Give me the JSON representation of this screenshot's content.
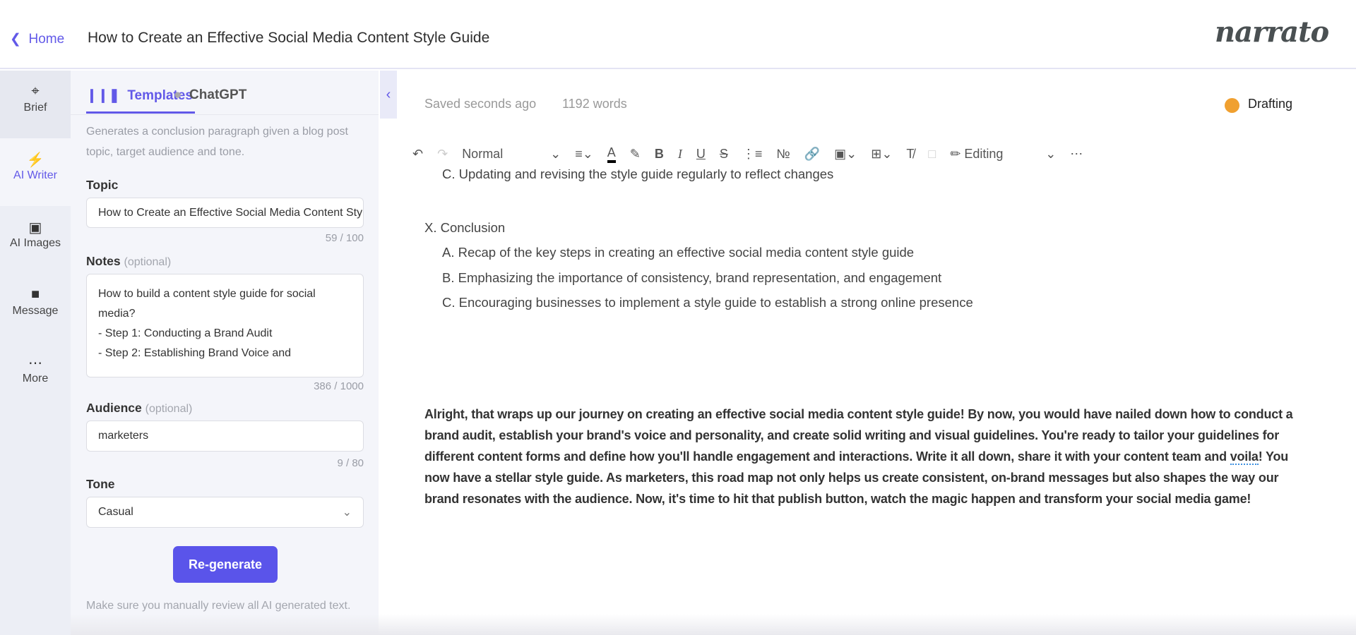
{
  "header": {
    "home_label": "Home",
    "title": "How to Create an Effective Social Media Content Style Guide",
    "logo": "narrato"
  },
  "rail": {
    "items": [
      {
        "label": "Brief",
        "icon": "crosshair-icon"
      },
      {
        "label": "AI Writer",
        "icon": "lightning-icon"
      },
      {
        "label": "AI Images",
        "icon": "image-icon"
      },
      {
        "label": "Message",
        "icon": "chat-icon"
      },
      {
        "label": "More",
        "icon": "more-icon"
      }
    ],
    "active": "AI Writer"
  },
  "panel": {
    "tabs": [
      {
        "label": "Templates",
        "active": true
      },
      {
        "label": "ChatGPT"
      }
    ],
    "description": "Generates a conclusion paragraph given a blog post topic, target audience and tone.",
    "topic": {
      "label": "Topic",
      "value": "How to Create an Effective Social Media Content Style Guide",
      "counter": "59 / 100"
    },
    "notes": {
      "label": "Notes",
      "optional": "(optional)",
      "value": "How to build a content style guide for social media?\n- Step 1: Conducting a Brand Audit\n- Step 2: Establishing Brand Voice and",
      "counter": "386 / 1000"
    },
    "audience": {
      "label": "Audience",
      "optional": "(optional)",
      "value": "marketers",
      "counter": "9 / 80"
    },
    "tone": {
      "label": "Tone",
      "value": "Casual"
    },
    "regenerate": "Re-generate",
    "footer": "Make sure you manually review all AI generated text."
  },
  "editor": {
    "saved": "Saved seconds ago",
    "words": "1192 words",
    "status": "Drafting",
    "status_color": "#f0a030",
    "toolbar": {
      "style": "Normal",
      "mode": "Editing"
    },
    "lines": [
      "C. Updating and revising the style guide regularly to reflect changes",
      "X. Conclusion",
      "A. Recap of the key steps in creating an effective social media content style guide",
      "B. Emphasizing the importance of consistency, brand representation, and engagement",
      "C. Encouraging businesses to implement a style guide to establish a strong online presence"
    ],
    "paragraph": {
      "before": "Alright, that wraps up our journey on creating an effective social media content style guide! By now, you would have nailed down how to conduct a brand audit, establish your brand's voice and personality, and create solid writing and visual guidelines. You're ready to tailor your guidelines for different content forms and define how you'll handle engagement and interactions. Write it all down, share it with your content team and ",
      "flagged": "voila",
      "after": "! You now have a stellar style guide. As marketers, this road map not only helps us create consistent, on-brand messages but also shapes the way our brand resonates with the audience. Now, it's time to hit that publish button, watch the magic happen and transform your social media game!"
    }
  }
}
